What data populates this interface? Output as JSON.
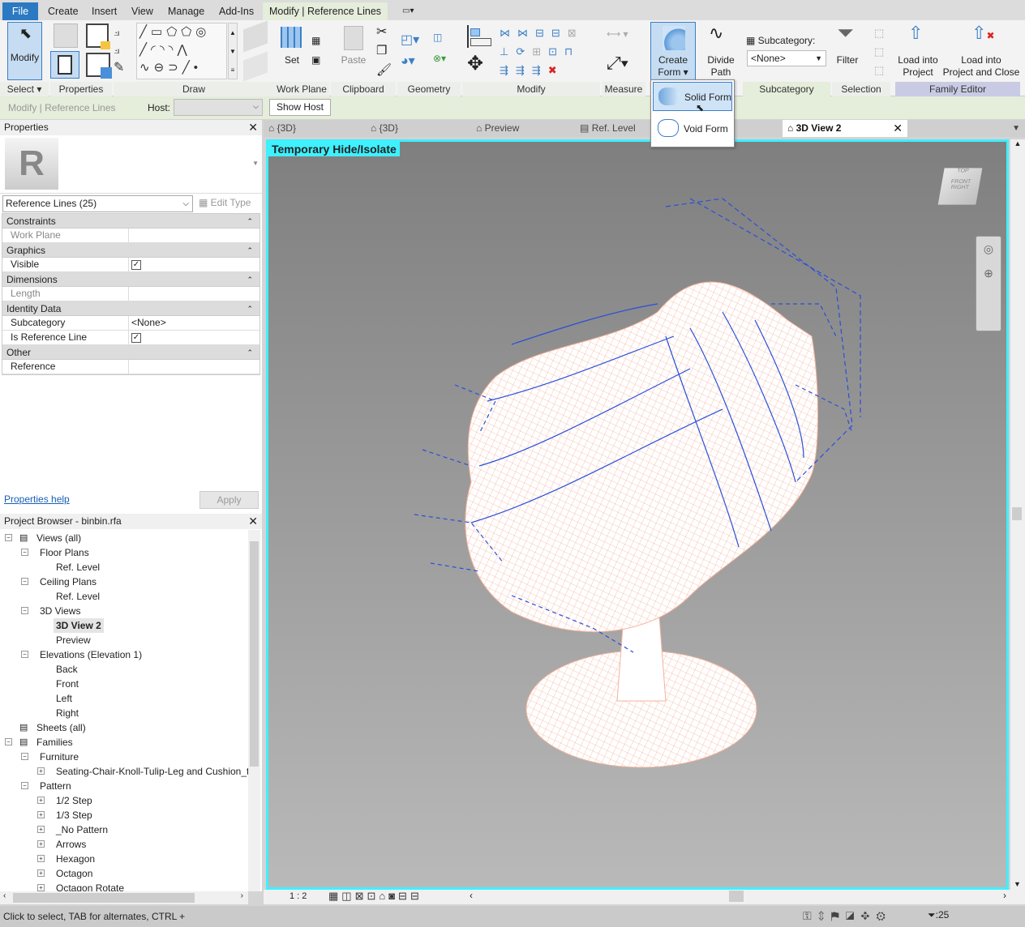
{
  "ribbon_tabs": [
    "File",
    "Create",
    "Insert",
    "View",
    "Manage",
    "Add-Ins",
    "Modify | Reference Lines"
  ],
  "active_tab": "Modify | Reference Lines",
  "panels": {
    "select": "Select",
    "properties": "Properties",
    "draw": "Draw",
    "work_plane": "Work Plane",
    "clipboard": "Clipboard",
    "geometry": "Geometry",
    "modify": "Modify",
    "measure": "Measure",
    "subcategory": "Subcategory",
    "selection": "Selection",
    "family_editor": "Family Editor"
  },
  "buttons": {
    "modify": "Modify",
    "set": "Set",
    "paste": "Paste",
    "create_form": [
      "Create",
      "Form"
    ],
    "divide_path": [
      "Divide",
      "Path"
    ],
    "filter": "Filter",
    "load_into_project": [
      "Load into",
      "Project"
    ],
    "load_close": [
      "Load into",
      "Project and Close"
    ]
  },
  "subcategory": {
    "label": "Subcategory:",
    "value": "<None>"
  },
  "create_form_menu": [
    "Solid Form",
    "Void Form"
  ],
  "options_bar": {
    "context": "Modify | Reference Lines",
    "host_label": "Host:",
    "host_value": "",
    "show_host": "Show Host"
  },
  "properties": {
    "title": "Properties",
    "type_selector": "Reference Lines (25)",
    "edit_type": "Edit Type",
    "groups": [
      {
        "name": "Constraints",
        "rows": [
          {
            "k": "Work Plane",
            "v": "",
            "disabled": true
          }
        ]
      },
      {
        "name": "Graphics",
        "rows": [
          {
            "k": "Visible",
            "v": "checkbox"
          }
        ]
      },
      {
        "name": "Dimensions",
        "rows": [
          {
            "k": "Length",
            "v": "",
            "disabled": true
          }
        ]
      },
      {
        "name": "Identity Data",
        "rows": [
          {
            "k": "Subcategory",
            "v": "<None>"
          },
          {
            "k": "Is Reference Line",
            "v": "checkbox"
          }
        ]
      },
      {
        "name": "Other",
        "rows": [
          {
            "k": "Reference",
            "v": ""
          }
        ]
      }
    ],
    "help": "Properties help",
    "apply": "Apply"
  },
  "project_browser": {
    "title": "Project Browser - binbin.rfa",
    "items": [
      {
        "t": "Views (all)",
        "l": 0,
        "pm": "-"
      },
      {
        "t": "Floor Plans",
        "l": 1,
        "pm": "-"
      },
      {
        "t": "Ref. Level",
        "l": 2
      },
      {
        "t": "Ceiling Plans",
        "l": 1,
        "pm": "-"
      },
      {
        "t": "Ref. Level",
        "l": 2
      },
      {
        "t": "3D Views",
        "l": 1,
        "pm": "-"
      },
      {
        "t": "3D View 2",
        "l": 2,
        "bold": true
      },
      {
        "t": "Preview",
        "l": 2
      },
      {
        "t": "Elevations (Elevation 1)",
        "l": 1,
        "pm": "-"
      },
      {
        "t": "Back",
        "l": 2
      },
      {
        "t": "Front",
        "l": 2
      },
      {
        "t": "Left",
        "l": 2
      },
      {
        "t": "Right",
        "l": 2
      },
      {
        "t": "Sheets (all)",
        "l": 0
      },
      {
        "t": "Families",
        "l": 0,
        "pm": "-"
      },
      {
        "t": "Furniture",
        "l": 1,
        "pm": "-"
      },
      {
        "t": "Seating-Chair-Knoll-Tulip-Leg and Cushion_t",
        "l": 2,
        "pm": "+"
      },
      {
        "t": "Pattern",
        "l": 1,
        "pm": "-"
      },
      {
        "t": "1/2 Step",
        "l": 2,
        "pm": "+"
      },
      {
        "t": "1/3 Step",
        "l": 2,
        "pm": "+"
      },
      {
        "t": "_No Pattern",
        "l": 2,
        "pm": "+"
      },
      {
        "t": "Arrows",
        "l": 2,
        "pm": "+"
      },
      {
        "t": "Hexagon",
        "l": 2,
        "pm": "+"
      },
      {
        "t": "Octagon",
        "l": 2,
        "pm": "+"
      },
      {
        "t": "Octagon Rotate",
        "l": 2,
        "pm": "+"
      }
    ]
  },
  "view_tabs": [
    "{3D}",
    "{3D}",
    "Preview",
    "Ref. Level",
    "3D View 2"
  ],
  "active_view_tab": "3D View 2",
  "viewport": {
    "banner": "Temporary Hide/Isolate",
    "viewcube": [
      "TOP",
      "FRONT",
      "RIGHT"
    ],
    "scale": "1 : 2"
  },
  "status": {
    "text": "Click to select, TAB for alternates, CTRL +",
    "filter_count": ":25"
  },
  "colors": {
    "file_tab": "#2b79c2",
    "highlight": "#3ff0ff",
    "mesh": "#f5b39c",
    "ref_lines": "#2a4fd8"
  }
}
